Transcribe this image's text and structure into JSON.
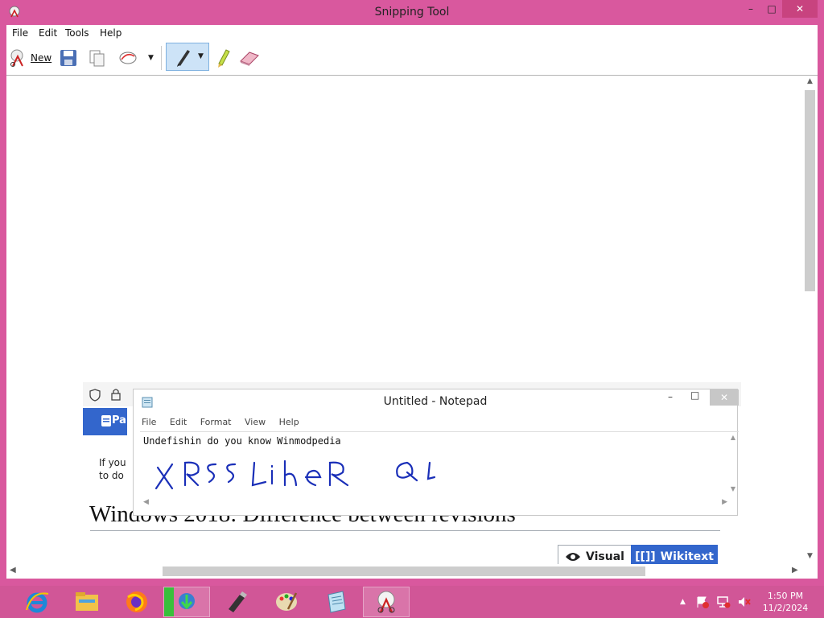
{
  "window": {
    "title": "Snipping Tool",
    "minimize": "–",
    "maximize": "□",
    "close": "✕"
  },
  "menu": {
    "file": "File",
    "edit": "Edit",
    "tools": "Tools",
    "help": "Help"
  },
  "toolbar": {
    "new_label": "New"
  },
  "capture": {
    "blue_tab_text": "Pa",
    "body_line1": "If you",
    "body_line2": "to do",
    "heading": "Windows 2018: Difference between revisions",
    "visual_label": "Visual",
    "wikitext_label": "Wikitext"
  },
  "notepad": {
    "title": "Untitled - Notepad",
    "menu": {
      "file": "File",
      "edit": "Edit",
      "format": "Format",
      "view": "View",
      "help": "Help"
    },
    "text": "Undefishin do you know Winmodpedia",
    "handwriting_color": "#1a2fb8"
  },
  "taskbar": {
    "apps": [
      "internet-explorer",
      "file-explorer",
      "firefox",
      "download-manager",
      "usb-drive",
      "paint",
      "notepad",
      "snipping-tool"
    ],
    "time": "1:50 PM",
    "date": "11/2/2024"
  },
  "colors": {
    "frame": "#d9589e",
    "taskbar": "#d15697",
    "accent_blue": "#3366cc"
  }
}
